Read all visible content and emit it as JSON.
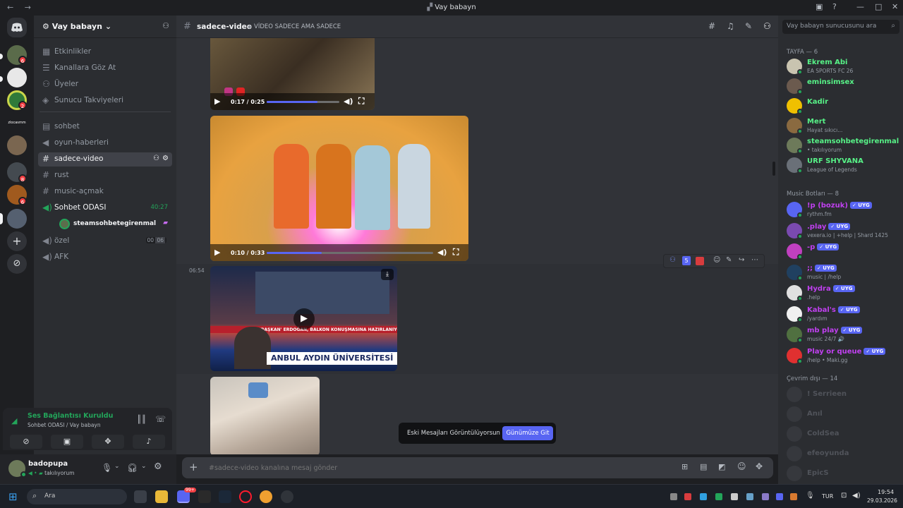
{
  "window": {
    "title": "Vay babayn",
    "nav_icons": "← →"
  },
  "server": {
    "name": "Vay babayn"
  },
  "channel_list": {
    "top_items": [
      "Etkinlikler",
      "Kanallara Göz At",
      "Üyeler",
      "Sunucu Takviyeleri"
    ],
    "channels": [
      "sohbet",
      "oyun-haberleri",
      "sadece-video",
      "rust",
      "music-açmak"
    ],
    "voice_channel": {
      "name": "Sohbet ODASI",
      "time": "40:27",
      "member": "steamsohbetegirenmal"
    },
    "private": "özel",
    "afk": "AFK",
    "afk_counts": [
      "00",
      "06"
    ]
  },
  "voice_panel": {
    "status": "Ses Bağlantısı Kuruldu",
    "location": "Sohbet ODASI / Vay babayn"
  },
  "user_panel": {
    "name": "badopupa",
    "status": "takılıyorum"
  },
  "chat_header": {
    "channel": "sadece-video",
    "topic": "VİDEO SADECE AMA SADECE"
  },
  "messages": {
    "video1_time": "0:17 / 0:25",
    "video1_progress": 0.7,
    "video2_time": "0:10 / 0:33",
    "video2_progress": 0.33,
    "timestamp": "06:54",
    "news_caption": "'BAŞKAN' ERDOĞAN, BALKON KONUŞMASINA HAZIRLANIYOR",
    "news_banner": "ANBUL AYDIN ÜNİVERSİTESİ",
    "hover_count": "5"
  },
  "toast": {
    "text": "Eski Mesajları Görüntülüyorsun",
    "button": "Günümüze Git"
  },
  "composer": {
    "placeholder": "#sadece-video kanalına mesaj gönder"
  },
  "members": {
    "search_placeholder": "Vay babayn sunucusunu ara",
    "group1_title": "TAYFA — 6",
    "group1": [
      {
        "name": "Ekrem Abi",
        "sub": "EA SPORTS FC 26",
        "color": "#57f287"
      },
      {
        "name": "eminsimsex",
        "sub": "",
        "color": "#57f287"
      },
      {
        "name": "Kadir",
        "sub": "",
        "color": "#57f287"
      },
      {
        "name": "Mert",
        "sub": "Hayat sıkıcı...",
        "color": "#57f287"
      },
      {
        "name": "steamsohbetegirenmal",
        "sub": "• takılıyorum",
        "color": "#57f287"
      },
      {
        "name": "URF SHYVANA",
        "sub": "League of Legends",
        "color": "#57f287"
      }
    ],
    "group2_title": "Music Botları — 8",
    "group2": [
      {
        "name": "!p (bozuk)",
        "sub": "rythm.fm",
        "tag": "✓ UYG"
      },
      {
        "name": ".play",
        "sub": "vexera.io | +help | Shard 1425",
        "tag": "✓ UYG"
      },
      {
        "name": "-p",
        "sub": "",
        "tag": "✓ UYG"
      },
      {
        "name": ";;",
        "sub": "music | /help",
        "tag": "✓ UYG"
      },
      {
        "name": "Hydra",
        "sub": ".help",
        "tag": "✓ UYG"
      },
      {
        "name": "Kabal's",
        "sub": "/yardım",
        "tag": "✓ UYG"
      },
      {
        "name": "mb play",
        "sub": "music 24/7 🔊",
        "tag": "✓ UYG"
      },
      {
        "name": "Play or queue",
        "sub": "/help • Maki.gg",
        "tag": "✓ UYG"
      }
    ],
    "group3_title": "Çevrim dışı — 14",
    "group3": [
      "! Serrieen",
      "Anıl",
      "ColdSea",
      "efeoyunda",
      "EpicS"
    ]
  },
  "taskbar": {
    "search": "Ara",
    "lang": "TUR",
    "time": "19:54",
    "date": "29.03.2026",
    "discord_badge": "99+"
  },
  "guild_badges": [
    "6",
    "2",
    "8",
    "6"
  ]
}
